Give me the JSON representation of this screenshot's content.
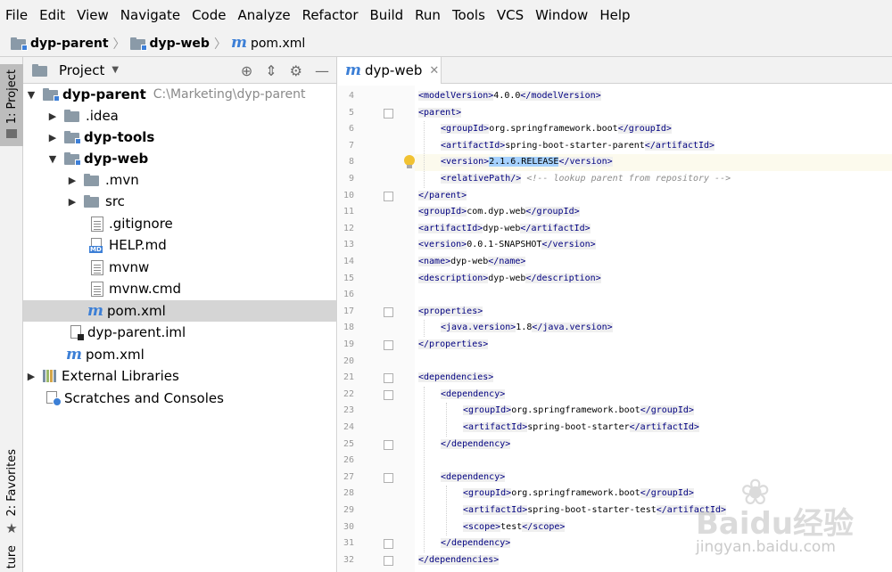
{
  "menu": [
    "File",
    "Edit",
    "View",
    "Navigate",
    "Code",
    "Analyze",
    "Refactor",
    "Build",
    "Run",
    "Tools",
    "VCS",
    "Window",
    "Help"
  ],
  "breadcrumb": [
    "dyp-parent",
    "dyp-web",
    "pom.xml"
  ],
  "left_strip": {
    "project": "1: Project",
    "favorites": "2: Favorites",
    "structure": "ture"
  },
  "project_panel": {
    "title": "Project",
    "tree": [
      {
        "label": "dyp-parent",
        "path": "C:\\Marketing\\dyp-parent"
      },
      {
        "label": ".idea"
      },
      {
        "label": "dyp-tools"
      },
      {
        "label": "dyp-web"
      },
      {
        "label": ".mvn"
      },
      {
        "label": "src"
      },
      {
        "label": ".gitignore"
      },
      {
        "label": "HELP.md"
      },
      {
        "label": "mvnw"
      },
      {
        "label": "mvnw.cmd"
      },
      {
        "label": "pom.xml"
      },
      {
        "label": "dyp-parent.iml"
      },
      {
        "label": "pom.xml"
      },
      {
        "label": "External Libraries"
      },
      {
        "label": "Scratches and Consoles"
      }
    ],
    "md_badge": "MD"
  },
  "editor": {
    "tab": "dyp-web",
    "line_numbers": [
      "4",
      "5",
      "6",
      "7",
      "8",
      "9",
      "10",
      "11",
      "12",
      "13",
      "14",
      "15",
      "16",
      "17",
      "18",
      "19",
      "20",
      "21",
      "22",
      "23",
      "24",
      "25",
      "26",
      "27",
      "28",
      "29",
      "30",
      "31",
      "32"
    ],
    "lines": [
      [
        {
          "t": "<modelVersion>"
        },
        {
          "v": "4.0.0"
        },
        {
          "t": "</modelVersion>"
        }
      ],
      [
        {
          "t": "<parent>"
        }
      ],
      [
        {
          "t": "<groupId>"
        },
        {
          "v": "org.springframework.boot"
        },
        {
          "t": "</groupId>"
        }
      ],
      [
        {
          "t": "<artifactId>"
        },
        {
          "v": "spring-boot-starter-parent"
        },
        {
          "t": "</artifactId>"
        }
      ],
      [
        {
          "t": "<version>"
        },
        {
          "s": "2.1.6.RELEASE"
        },
        {
          "t": "</version>"
        }
      ],
      [
        {
          "t": "<relativePath/>"
        },
        {
          "v": " "
        },
        {
          "c": "<!-- lookup parent from repository -->"
        }
      ],
      [
        {
          "t": "</parent>"
        }
      ],
      [
        {
          "t": "<groupId>"
        },
        {
          "v": "com.dyp.web"
        },
        {
          "t": "</groupId>"
        }
      ],
      [
        {
          "t": "<artifactId>"
        },
        {
          "v": "dyp-web"
        },
        {
          "t": "</artifactId>"
        }
      ],
      [
        {
          "t": "<version>"
        },
        {
          "v": "0.0.1-SNAPSHOT"
        },
        {
          "t": "</version>"
        }
      ],
      [
        {
          "t": "<name>"
        },
        {
          "v": "dyp-web"
        },
        {
          "t": "</name>"
        }
      ],
      [
        {
          "t": "<description>"
        },
        {
          "v": "dyp-web"
        },
        {
          "t": "</description>"
        }
      ],
      [],
      [
        {
          "t": "<properties>"
        }
      ],
      [
        {
          "t": "<java.version>"
        },
        {
          "v": "1.8"
        },
        {
          "t": "</java.version>"
        }
      ],
      [
        {
          "t": "</properties>"
        }
      ],
      [],
      [
        {
          "t": "<dependencies>"
        }
      ],
      [
        {
          "t": "<dependency>"
        }
      ],
      [
        {
          "t": "<groupId>"
        },
        {
          "v": "org.springframework.boot"
        },
        {
          "t": "</groupId>"
        }
      ],
      [
        {
          "t": "<artifactId>"
        },
        {
          "v": "spring-boot-starter"
        },
        {
          "t": "</artifactId>"
        }
      ],
      [
        {
          "t": "</dependency>"
        }
      ],
      [],
      [
        {
          "t": "<dependency>"
        }
      ],
      [
        {
          "t": "<groupId>"
        },
        {
          "v": "org.springframework.boot"
        },
        {
          "t": "</groupId>"
        }
      ],
      [
        {
          "t": "<artifactId>"
        },
        {
          "v": "spring-boot-starter-test"
        },
        {
          "t": "</artifactId>"
        }
      ],
      [
        {
          "t": "<scope>"
        },
        {
          "v": "test"
        },
        {
          "t": "</scope>"
        }
      ],
      [
        {
          "t": "</dependency>"
        }
      ],
      [
        {
          "t": "</dependencies>"
        }
      ]
    ]
  },
  "watermark": {
    "brand": "Baidu经验",
    "site": "jingyan.baidu.com"
  },
  "colors": {
    "tag": "#000080",
    "selection": "#a6d2ff",
    "current_line": "#fcfaed",
    "maven_blue": "#3c7fd6",
    "bulb": "#f1c232"
  }
}
